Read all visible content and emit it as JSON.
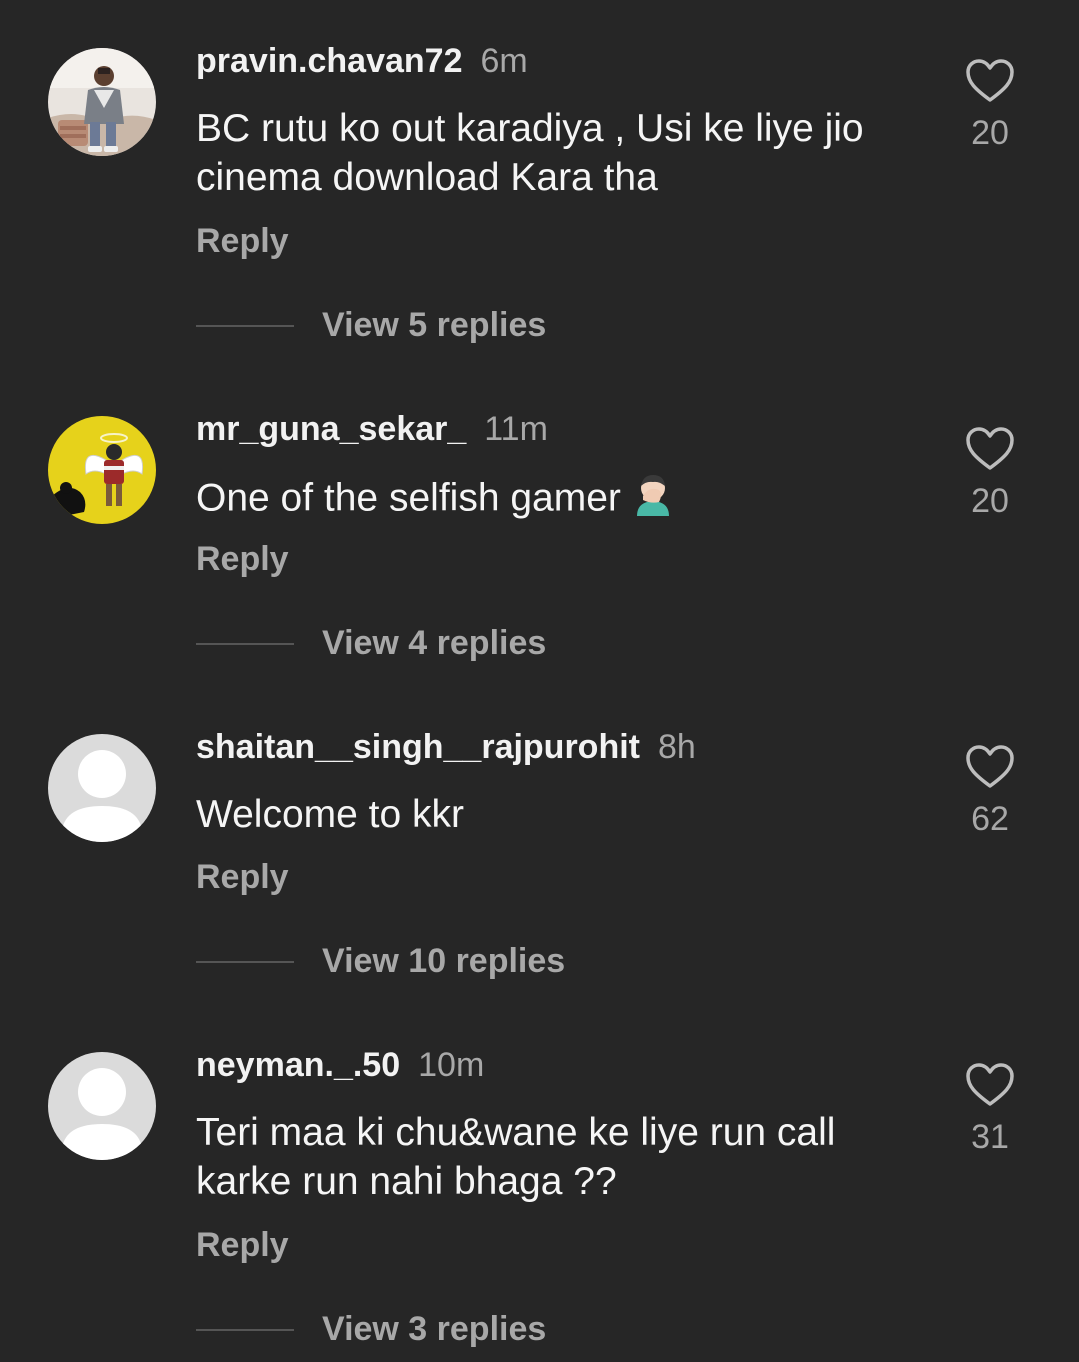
{
  "comments": [
    {
      "username": "pravin.chavan72",
      "time": "6m",
      "text": "BC rutu ko out karadiya , Usi ke liye jio cinema download Kara tha",
      "reply_label": "Reply",
      "view_replies": "View 5 replies",
      "likes": "20",
      "avatar": "photo-avatar"
    },
    {
      "username": "mr_guna_sekar_",
      "time": "11m",
      "text": "One of the selfish gamer",
      "emoji": "facepalm-emoji",
      "reply_label": "Reply",
      "view_replies": "View 4 replies",
      "likes": "20",
      "avatar": "angel-avatar"
    },
    {
      "username": "shaitan__singh__rajpurohit",
      "time": "8h",
      "text": "Welcome to kkr",
      "reply_label": "Reply",
      "view_replies": "View 10 replies",
      "likes": "62",
      "avatar": "default-avatar"
    },
    {
      "username": "neyman._.50",
      "time": "10m",
      "text": "Teri maa ki chu&wane ke liye run call karke run nahi bhaga ??",
      "reply_label": "Reply",
      "view_replies": "View 3 replies",
      "likes": "31",
      "avatar": "default-avatar"
    }
  ],
  "colors": {
    "background": "#262626",
    "text": "#f5f5f5",
    "muted": "#a8a8a8"
  }
}
